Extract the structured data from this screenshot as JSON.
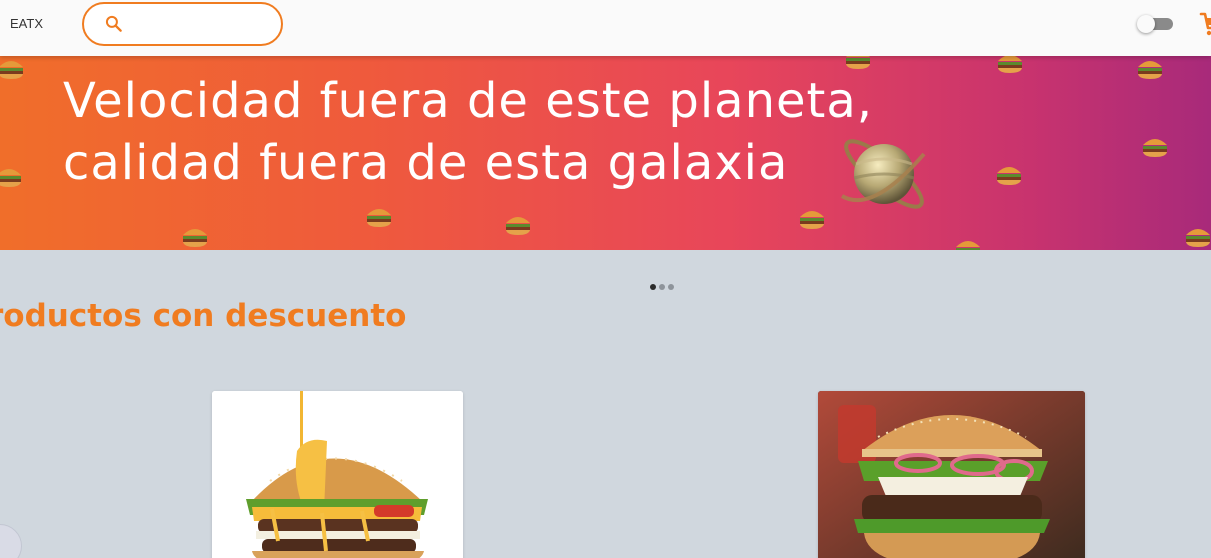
{
  "app": {
    "logo": "EATX"
  },
  "search": {
    "placeholder": "",
    "value": ""
  },
  "theme_toggle": {
    "state": "off"
  },
  "banner": {
    "line1": "Velocidad fuera de este planeta,",
    "line2": "calidad fuera de esta galaxia"
  },
  "carousel": {
    "slide_count": 3,
    "active_index": 0
  },
  "section": {
    "title": "roductos con descuento"
  },
  "products": [
    {
      "name": "",
      "image": "cheese-burger-image"
    },
    {
      "name": "",
      "image": "onion-burger-image"
    }
  ],
  "colors": {
    "accent": "#f07c20",
    "banner_start": "#f06e2a",
    "banner_end": "#a82a7a",
    "page_bg": "#d0d7de"
  }
}
